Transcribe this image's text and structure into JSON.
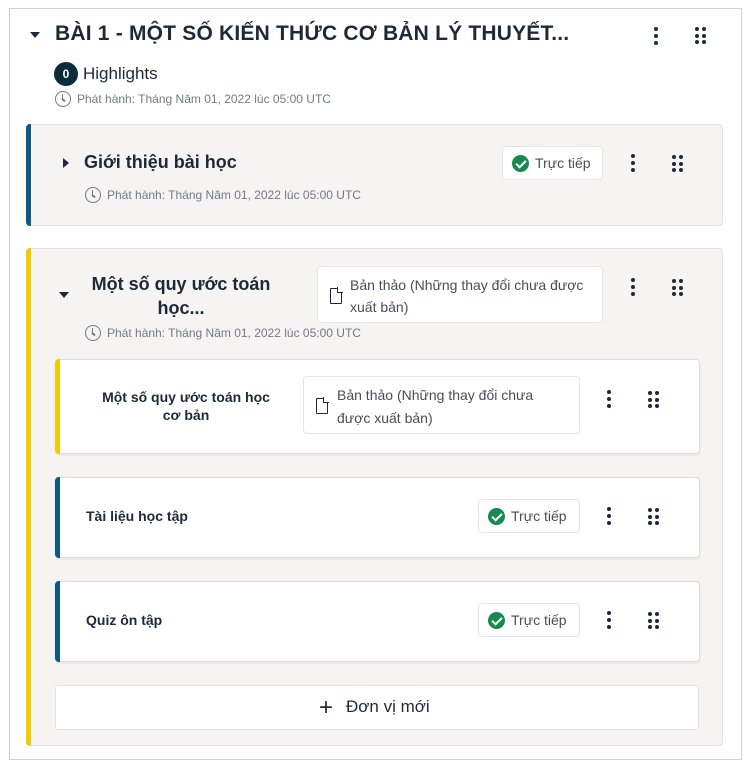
{
  "section": {
    "title": "BÀI 1 - MỘT SỐ KIẾN THỨC CƠ BẢN LÝ THUYẾT...",
    "highlights_count": "0",
    "highlights_label": "Highlights",
    "published": "Phát hành: Tháng Năm 01, 2022 lúc 05:00 UTC"
  },
  "subsections": [
    {
      "title": "Giới thiệu bài học",
      "status": "Trực tiếp",
      "published": "Phát hành: Tháng Năm 01, 2022 lúc 05:00 UTC"
    },
    {
      "title_line1": "Một số quy ước toán",
      "title_line2": "học...",
      "status_line1": "Bản thảo (Những thay đổi chưa được",
      "status_line2": "xuất bản)",
      "published": "Phát hành: Tháng Năm 01, 2022 lúc 05:00 UTC",
      "units": [
        {
          "title_line1": "Một số quy ước toán học",
          "title_line2": "cơ bản",
          "status_line1": "Bản thảo (Những thay đổi chưa",
          "status_line2": "được xuất bản)"
        },
        {
          "title": "Tài liệu học tập",
          "status": "Trực tiếp"
        },
        {
          "title": "Quiz ôn tập",
          "status": "Trực tiếp"
        }
      ],
      "new_unit_label": "Đơn vị mới"
    }
  ],
  "colors": {
    "live": "#0a5a82",
    "draft": "#f0cc00",
    "check": "#178a50"
  }
}
